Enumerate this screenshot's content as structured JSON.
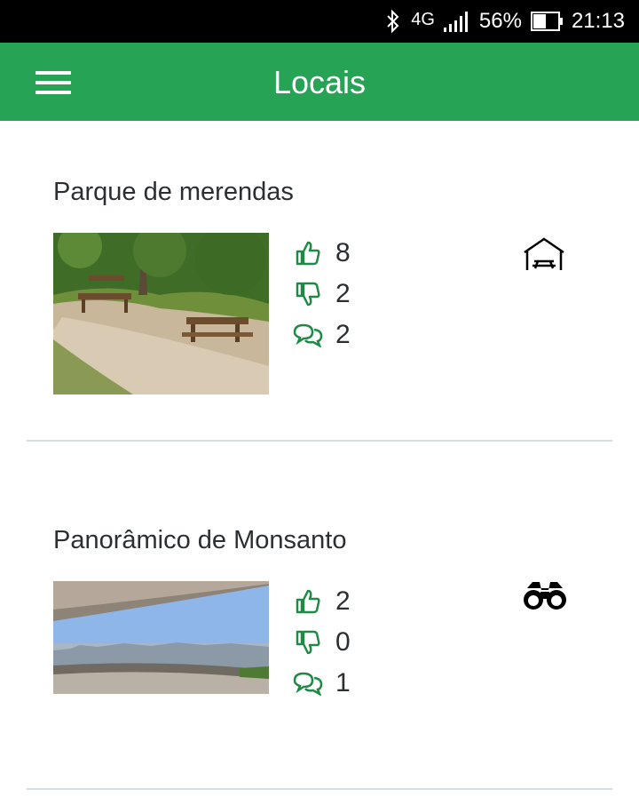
{
  "status_bar": {
    "network": "4G",
    "battery_percent": "56%",
    "time": "21:13",
    "icons": [
      "bluetooth-icon",
      "signal-icon",
      "battery-icon"
    ]
  },
  "app_bar": {
    "title": "Locais",
    "menu_icon": "hamburger-menu-icon"
  },
  "colors": {
    "accent": "#27a356",
    "icon_green": "#1f8a45",
    "divider": "#d7dbe2"
  },
  "places": [
    {
      "name": "Parque de merendas",
      "likes": "8",
      "dislikes": "2",
      "comments": "2",
      "category_icon": "picnic-shelter-icon",
      "image": "picnic-park-photo"
    },
    {
      "name": "Panorâmico de Monsanto",
      "likes": "2",
      "dislikes": "0",
      "comments": "1",
      "category_icon": "binoculars-icon",
      "image": "panoramic-view-photo"
    }
  ]
}
